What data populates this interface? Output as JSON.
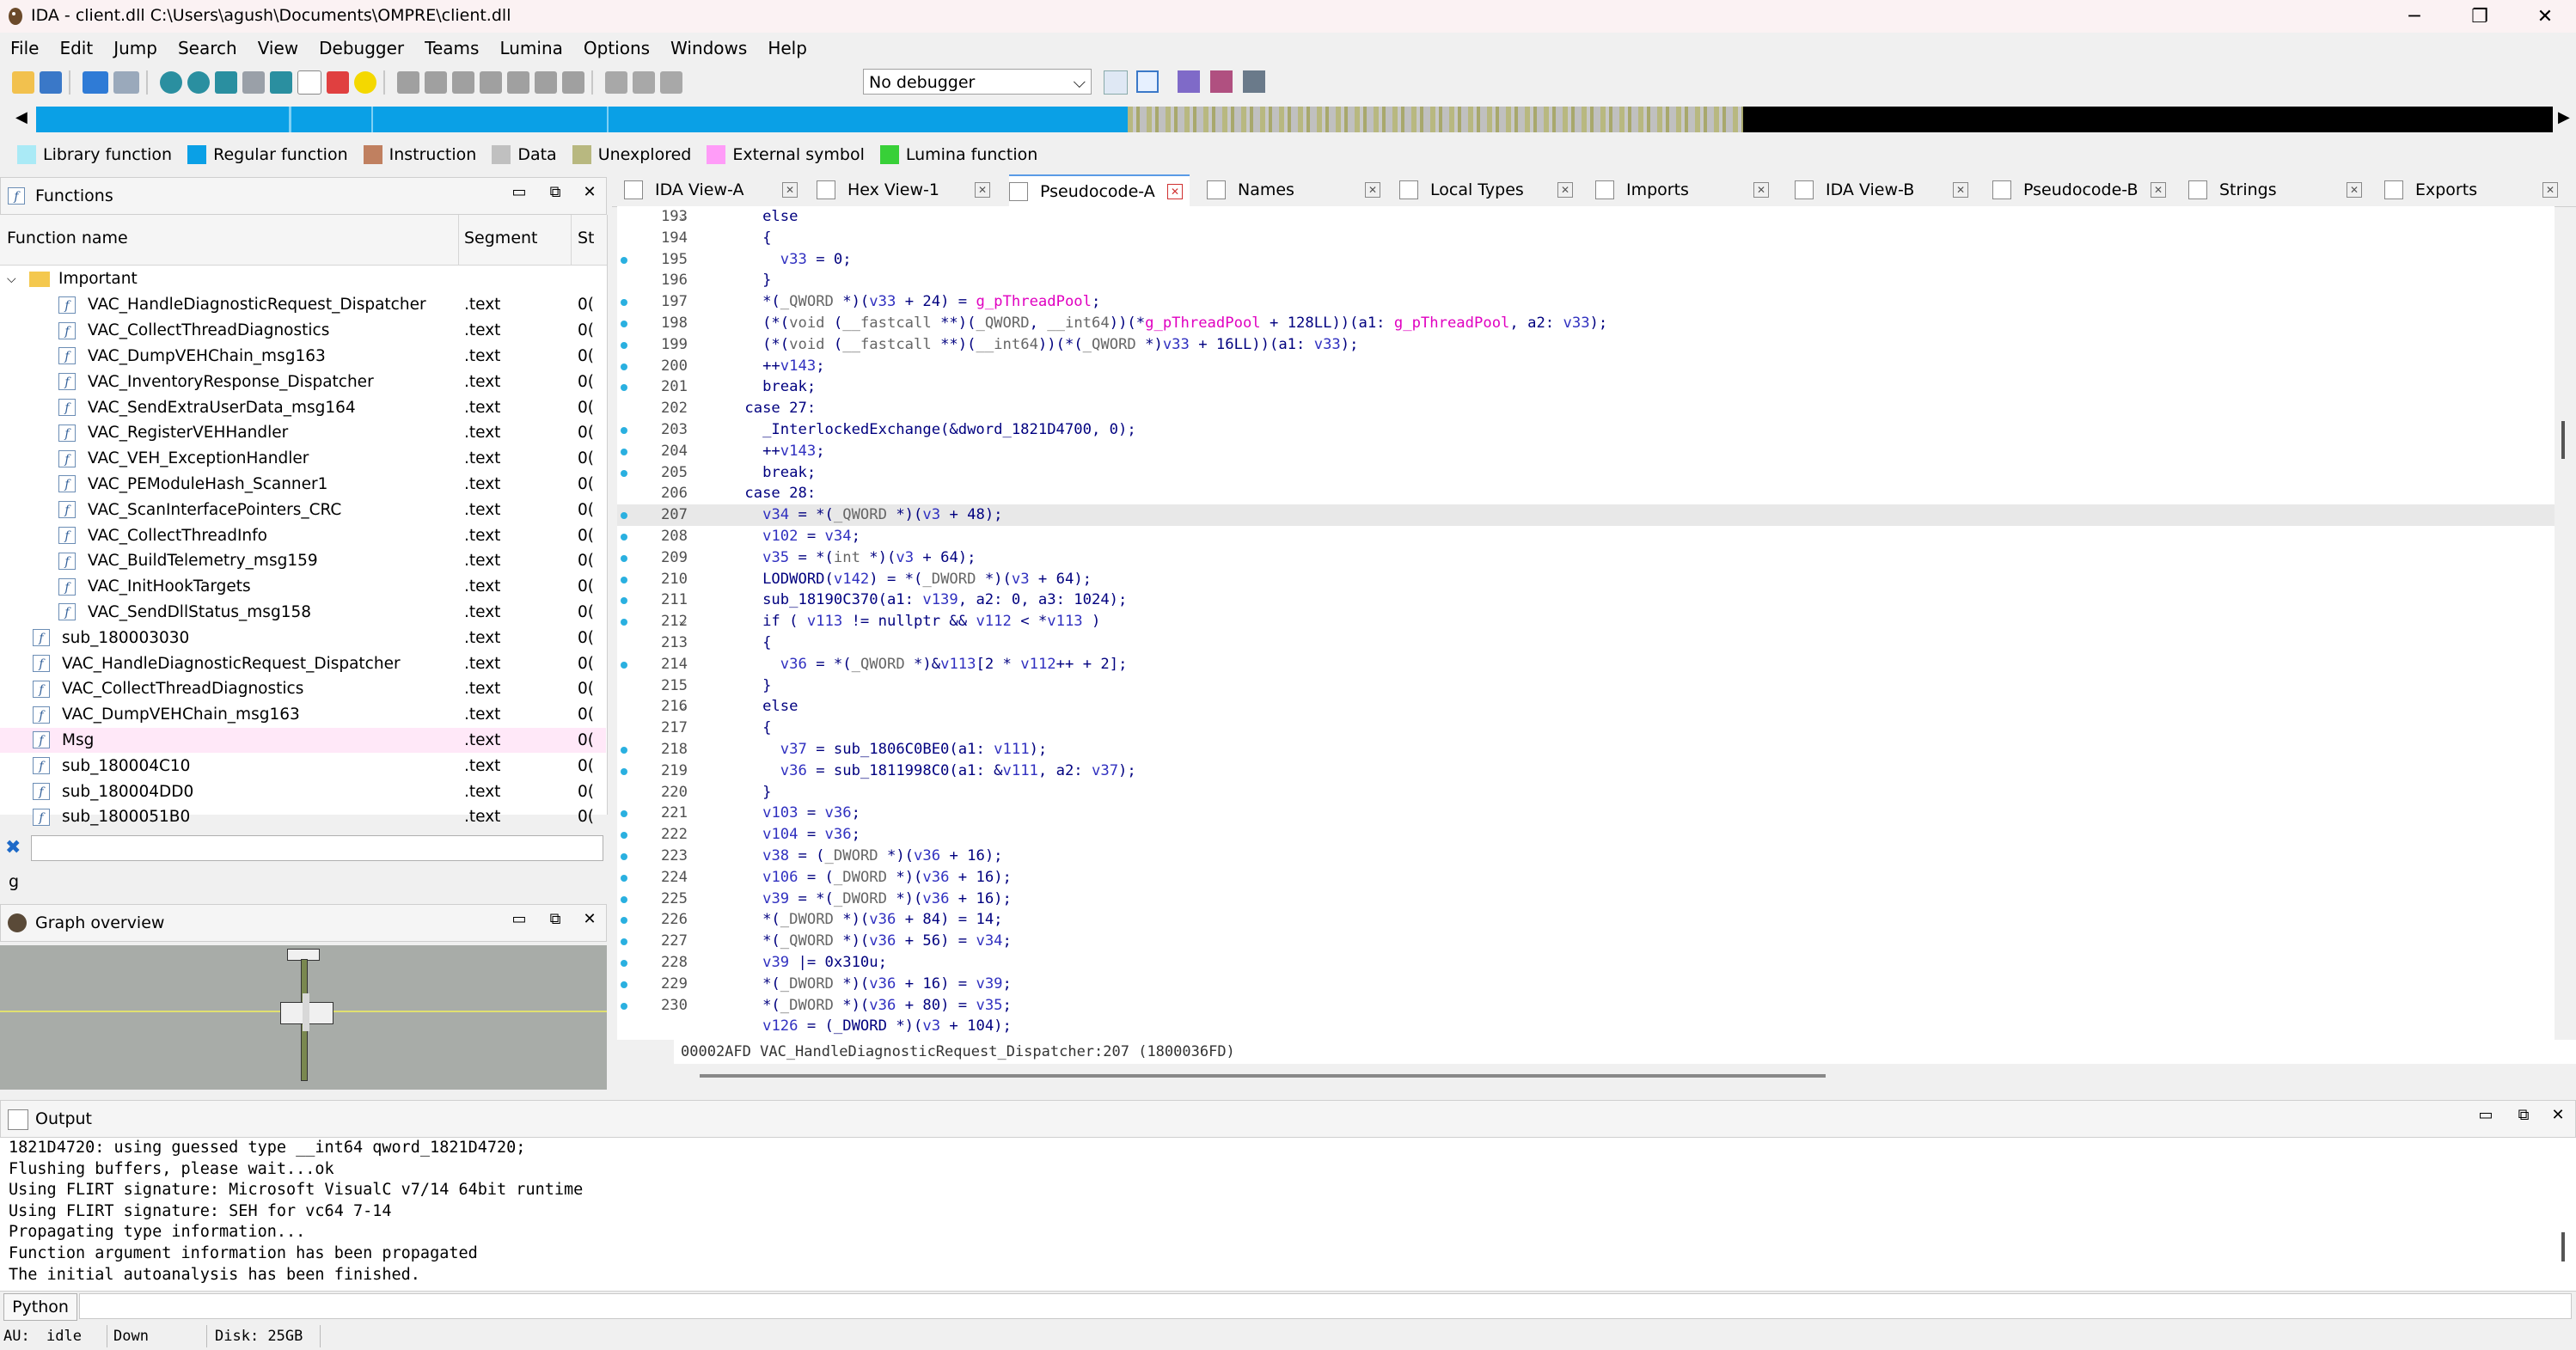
{
  "titlebar": {
    "title": "IDA - client.dll C:\\Users\\agush\\Documents\\OMPRE\\client.dll",
    "minimize": "─",
    "maximize": "❐",
    "close": "✕"
  },
  "menu": [
    "File",
    "Edit",
    "Jump",
    "Search",
    "View",
    "Debugger",
    "Teams",
    "Lumina",
    "Options",
    "Windows",
    "Help"
  ],
  "toolbar": {
    "debugger_select": "No debugger"
  },
  "legend": [
    {
      "label": "Library function",
      "color": "#aaeaf6"
    },
    {
      "label": "Regular function",
      "color": "#0aa0e6"
    },
    {
      "label": "Instruction",
      "color": "#c08060"
    },
    {
      "label": "Data",
      "color": "#c0c0c0"
    },
    {
      "label": "Unexplored",
      "color": "#b8b880"
    },
    {
      "label": "External symbol",
      "color": "#ff9cf8"
    },
    {
      "label": "Lumina function",
      "color": "#38d038"
    }
  ],
  "functions_pane": {
    "title": "Functions",
    "col_name": "Function name",
    "col_segment": "Segment",
    "col_st": "St",
    "folder": "Important",
    "rows": [
      {
        "name": "VAC_HandleDiagnosticRequest_Dispatcher",
        "seg": ".text",
        "st": "0(",
        "indent": true,
        "hl": false
      },
      {
        "name": "VAC_CollectThreadDiagnostics",
        "seg": ".text",
        "st": "0(",
        "indent": true,
        "hl": false
      },
      {
        "name": "VAC_DumpVEHChain_msg163",
        "seg": ".text",
        "st": "0(",
        "indent": true,
        "hl": false
      },
      {
        "name": "VAC_InventoryResponse_Dispatcher",
        "seg": ".text",
        "st": "0(",
        "indent": true,
        "hl": false
      },
      {
        "name": "VAC_SendExtraUserData_msg164",
        "seg": ".text",
        "st": "0(",
        "indent": true,
        "hl": false
      },
      {
        "name": "VAC_RegisterVEHHandler",
        "seg": ".text",
        "st": "0(",
        "indent": true,
        "hl": false
      },
      {
        "name": "VAC_VEH_ExceptionHandler",
        "seg": ".text",
        "st": "0(",
        "indent": true,
        "hl": false
      },
      {
        "name": "VAC_PEModuleHash_Scanner1",
        "seg": ".text",
        "st": "0(",
        "indent": true,
        "hl": false
      },
      {
        "name": "VAC_ScanInterfacePointers_CRC",
        "seg": ".text",
        "st": "0(",
        "indent": true,
        "hl": false
      },
      {
        "name": "VAC_CollectThreadInfo",
        "seg": ".text",
        "st": "0(",
        "indent": true,
        "hl": false
      },
      {
        "name": "VAC_BuildTelemetry_msg159",
        "seg": ".text",
        "st": "0(",
        "indent": true,
        "hl": false
      },
      {
        "name": "VAC_InitHookTargets",
        "seg": ".text",
        "st": "0(",
        "indent": true,
        "hl": false
      },
      {
        "name": "VAC_SendDllStatus_msg158",
        "seg": ".text",
        "st": "0(",
        "indent": true,
        "hl": false
      },
      {
        "name": "sub_180003030",
        "seg": ".text",
        "st": "0(",
        "indent": false,
        "hl": false
      },
      {
        "name": "VAC_HandleDiagnosticRequest_Dispatcher",
        "seg": ".text",
        "st": "0(",
        "indent": false,
        "hl": false
      },
      {
        "name": "VAC_CollectThreadDiagnostics",
        "seg": ".text",
        "st": "0(",
        "indent": false,
        "hl": false
      },
      {
        "name": "VAC_DumpVEHChain_msg163",
        "seg": ".text",
        "st": "0(",
        "indent": false,
        "hl": false
      },
      {
        "name": "Msg",
        "seg": ".text",
        "st": "0(",
        "indent": false,
        "hl": true
      },
      {
        "name": "sub_180004C10",
        "seg": ".text",
        "st": "0(",
        "indent": false,
        "hl": false
      },
      {
        "name": "sub_180004DD0",
        "seg": ".text",
        "st": "0(",
        "indent": false,
        "hl": false
      },
      {
        "name": "sub_1800051B0",
        "seg": ".text",
        "st": "0(",
        "indent": false,
        "hl": false
      }
    ],
    "filter_value": "",
    "filter_text": "g"
  },
  "graph_overview": {
    "title": "Graph overview"
  },
  "tabs": [
    {
      "label": "IDA View-A",
      "active": false
    },
    {
      "label": "Hex View-1",
      "active": false
    },
    {
      "label": "Pseudocode-A",
      "active": true
    },
    {
      "label": "Names",
      "active": false
    },
    {
      "label": "Local Types",
      "active": false
    },
    {
      "label": "Imports",
      "active": false
    },
    {
      "label": "IDA View-B",
      "active": false
    },
    {
      "label": "Pseudocode-B",
      "active": false
    },
    {
      "label": "Strings",
      "active": false
    },
    {
      "label": "Exports",
      "active": false
    }
  ],
  "code_lines": [
    {
      "n": "193",
      "bp": false,
      "fold": true,
      "html": "      else"
    },
    {
      "n": "194",
      "bp": false,
      "fold": false,
      "html": "      {"
    },
    {
      "n": "195",
      "bp": true,
      "fold": false,
      "html": "        <span class=\"v\">v33</span> = 0;"
    },
    {
      "n": "196",
      "bp": false,
      "fold": false,
      "html": "      }"
    },
    {
      "n": "197",
      "bp": true,
      "fold": false,
      "html": "      *(<span class=\"t\">_QWORD</span> *)(<span class=\"v\">v33</span> + 24) = <span class=\"g\">g_pThreadPool</span>;"
    },
    {
      "n": "198",
      "bp": true,
      "fold": false,
      "html": "      (*(<span class=\"t\">void</span> (<span class=\"t\">__fastcall</span> **)(<span class=\"t\">_QWORD</span>, <span class=\"t\">__int64</span>))(*<span class=\"g\">g_pThreadPool</span> + 128LL))(a1: <span class=\"g\">g_pThreadPool</span>, a2: <span class=\"v\">v33</span>);"
    },
    {
      "n": "199",
      "bp": true,
      "fold": false,
      "html": "      (*(<span class=\"t\">void</span> (<span class=\"t\">__fastcall</span> **)(<span class=\"t\">__int64</span>))(*(<span class=\"t\">_QWORD</span> *)<span class=\"v\">v33</span> + 16LL))(a1: <span class=\"v\">v33</span>);"
    },
    {
      "n": "200",
      "bp": true,
      "fold": false,
      "html": "      ++<span class=\"v\">v143</span>;"
    },
    {
      "n": "201",
      "bp": true,
      "fold": false,
      "html": "      break;"
    },
    {
      "n": "202",
      "bp": false,
      "fold": false,
      "html": "    case 27:"
    },
    {
      "n": "203",
      "bp": true,
      "fold": false,
      "html": "      _InterlockedExchange(&amp;dword_1821D4700, 0);"
    },
    {
      "n": "204",
      "bp": true,
      "fold": false,
      "html": "      ++<span class=\"v\">v143</span>;"
    },
    {
      "n": "205",
      "bp": true,
      "fold": false,
      "html": "      break;"
    },
    {
      "n": "206",
      "bp": false,
      "fold": false,
      "html": "    case 28:"
    },
    {
      "n": "207",
      "bp": true,
      "fold": false,
      "hl": true,
      "html": "      <span class=\"v\">v34</span> = *(<span class=\"t\">_QWORD</span> *)(<span class=\"v\">v3</span> + 48);"
    },
    {
      "n": "208",
      "bp": true,
      "fold": false,
      "html": "      <span class=\"v\">v102</span> = <span class=\"v\">v34</span>;"
    },
    {
      "n": "209",
      "bp": true,
      "fold": false,
      "html": "      <span class=\"v\">v35</span> = *(<span class=\"t\">int</span> *)(<span class=\"v\">v3</span> + 64);"
    },
    {
      "n": "210",
      "bp": true,
      "fold": false,
      "html": "      LODWORD(<span class=\"v\">v142</span>) = *(<span class=\"t\">_DWORD</span> *)(<span class=\"v\">v3</span> + 64);"
    },
    {
      "n": "211",
      "bp": true,
      "fold": false,
      "html": "      sub_18190C370(a1: <span class=\"v\">v139</span>, a2: 0, a3: 1024);"
    },
    {
      "n": "212",
      "bp": true,
      "fold": true,
      "html": "      if ( <span class=\"v\">v113</span> != nullptr &amp;&amp; <span class=\"v\">v112</span> &lt; *<span class=\"v\">v113</span> )"
    },
    {
      "n": "213",
      "bp": false,
      "fold": false,
      "html": "      {"
    },
    {
      "n": "214",
      "bp": true,
      "fold": false,
      "html": "        <span class=\"v\">v36</span> = *(<span class=\"t\">_QWORD</span> *)&amp;<span class=\"v\">v113</span>[2 * <span class=\"v\">v112</span>++ + 2];"
    },
    {
      "n": "215",
      "bp": false,
      "fold": false,
      "html": "      }"
    },
    {
      "n": "216",
      "bp": false,
      "fold": true,
      "html": "      else"
    },
    {
      "n": "217",
      "bp": false,
      "fold": false,
      "html": "      {"
    },
    {
      "n": "218",
      "bp": true,
      "fold": false,
      "html": "        <span class=\"v\">v37</span> = sub_1806C0BE0(a1: <span class=\"v\">v111</span>);"
    },
    {
      "n": "219",
      "bp": true,
      "fold": false,
      "html": "        <span class=\"v\">v36</span> = sub_1811998C0(a1: &amp;<span class=\"v\">v111</span>, a2: <span class=\"v\">v37</span>);"
    },
    {
      "n": "220",
      "bp": false,
      "fold": false,
      "html": "      }"
    },
    {
      "n": "221",
      "bp": true,
      "fold": false,
      "html": "      <span class=\"v\">v103</span> = <span class=\"v\">v36</span>;"
    },
    {
      "n": "222",
      "bp": true,
      "fold": false,
      "html": "      <span class=\"v\">v104</span> = <span class=\"v\">v36</span>;"
    },
    {
      "n": "223",
      "bp": true,
      "fold": false,
      "html": "      <span class=\"v\">v38</span> = (<span class=\"t\">_DWORD</span> *)(<span class=\"v\">v36</span> + 16);"
    },
    {
      "n": "224",
      "bp": true,
      "fold": false,
      "html": "      <span class=\"v\">v106</span> = (<span class=\"t\">_DWORD</span> *)(<span class=\"v\">v36</span> + 16);"
    },
    {
      "n": "225",
      "bp": true,
      "fold": false,
      "html": "      <span class=\"v\">v39</span> = *(<span class=\"t\">_DWORD</span> *)(<span class=\"v\">v36</span> + 16);"
    },
    {
      "n": "226",
      "bp": true,
      "fold": false,
      "html": "      *(<span class=\"t\">_DWORD</span> *)(<span class=\"v\">v36</span> + 84) = 14;"
    },
    {
      "n": "227",
      "bp": true,
      "fold": false,
      "html": "      *(<span class=\"t\">_QWORD</span> *)(<span class=\"v\">v36</span> + 56) = <span class=\"v\">v34</span>;"
    },
    {
      "n": "228",
      "bp": true,
      "fold": false,
      "html": "      <span class=\"v\">v39</span> |= 0x310u;"
    },
    {
      "n": "229",
      "bp": true,
      "fold": false,
      "html": "      *(<span class=\"t\">_DWORD</span> *)(<span class=\"v\">v36</span> + 16) = <span class=\"v\">v39</span>;"
    },
    {
      "n": "230",
      "bp": true,
      "fold": false,
      "html": "      *(<span class=\"t\">_DWORD</span> *)(<span class=\"v\">v36</span> + 80) = <span class=\"v\">v35</span>;"
    },
    {
      "n": "",
      "bp": false,
      "fold": false,
      "html": "      <span class=\"v\">v126</span> = (_DWORD *)(<span class=\"v\">v3</span> + 104);"
    }
  ],
  "code_status": "00002AFD VAC_HandleDiagnosticRequest_Dispatcher:207 (1800036FD)",
  "output": {
    "title": "Output",
    "lines": [
      "1821D4720: using guessed type __int64 qword_1821D4720;",
      "Flushing buffers, please wait...ok",
      "Using FLIRT signature: Microsoft VisualC v7/14 64bit runtime",
      "Using FLIRT signature: SEH for vc64 7-14",
      "Propagating type information...",
      "Function argument information has been propagated",
      "The initial autoanalysis has been finished."
    ],
    "python_label": "Python",
    "python_input": ""
  },
  "statusbar": {
    "au_label": "AU:",
    "au_state": "idle",
    "direction": "Down",
    "disk": "Disk: 25GB"
  }
}
